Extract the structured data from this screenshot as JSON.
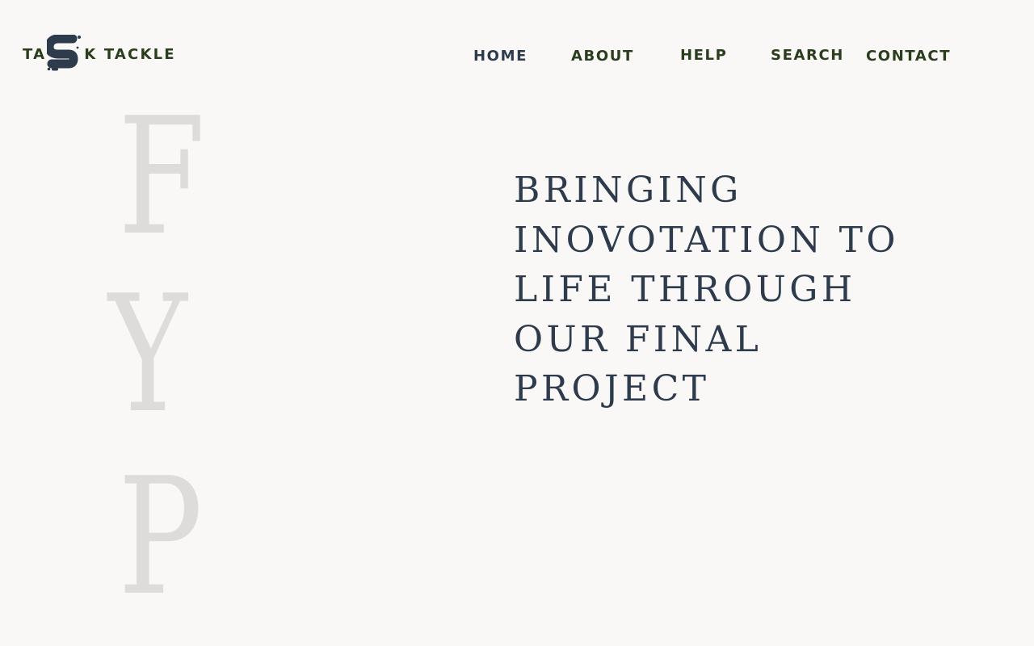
{
  "brand": {
    "text_before": "TA",
    "text_after": "K TACKLE",
    "logo_mark": "s-logo-mark",
    "color_text": "#2a3d1c",
    "color_mark": "#2d3b4c"
  },
  "nav": {
    "items": [
      {
        "label": "HOME",
        "active": true
      },
      {
        "label": "ABOUT"
      },
      {
        "label": "HELP"
      },
      {
        "label": "SEARCH"
      },
      {
        "label": "CONTACT"
      }
    ]
  },
  "hero": {
    "letters": [
      "F",
      "Y",
      "P"
    ],
    "headline_lines": [
      "BRINGING",
      "INOVOTATION TO",
      "LIFE THROUGH",
      "OUR FINAL",
      "PROJECT"
    ]
  },
  "colors": {
    "background": "#f9f8f6",
    "headline": "#2d3b4c",
    "watermark_letters": "#dddcda",
    "nav": "#2a3d1c"
  }
}
